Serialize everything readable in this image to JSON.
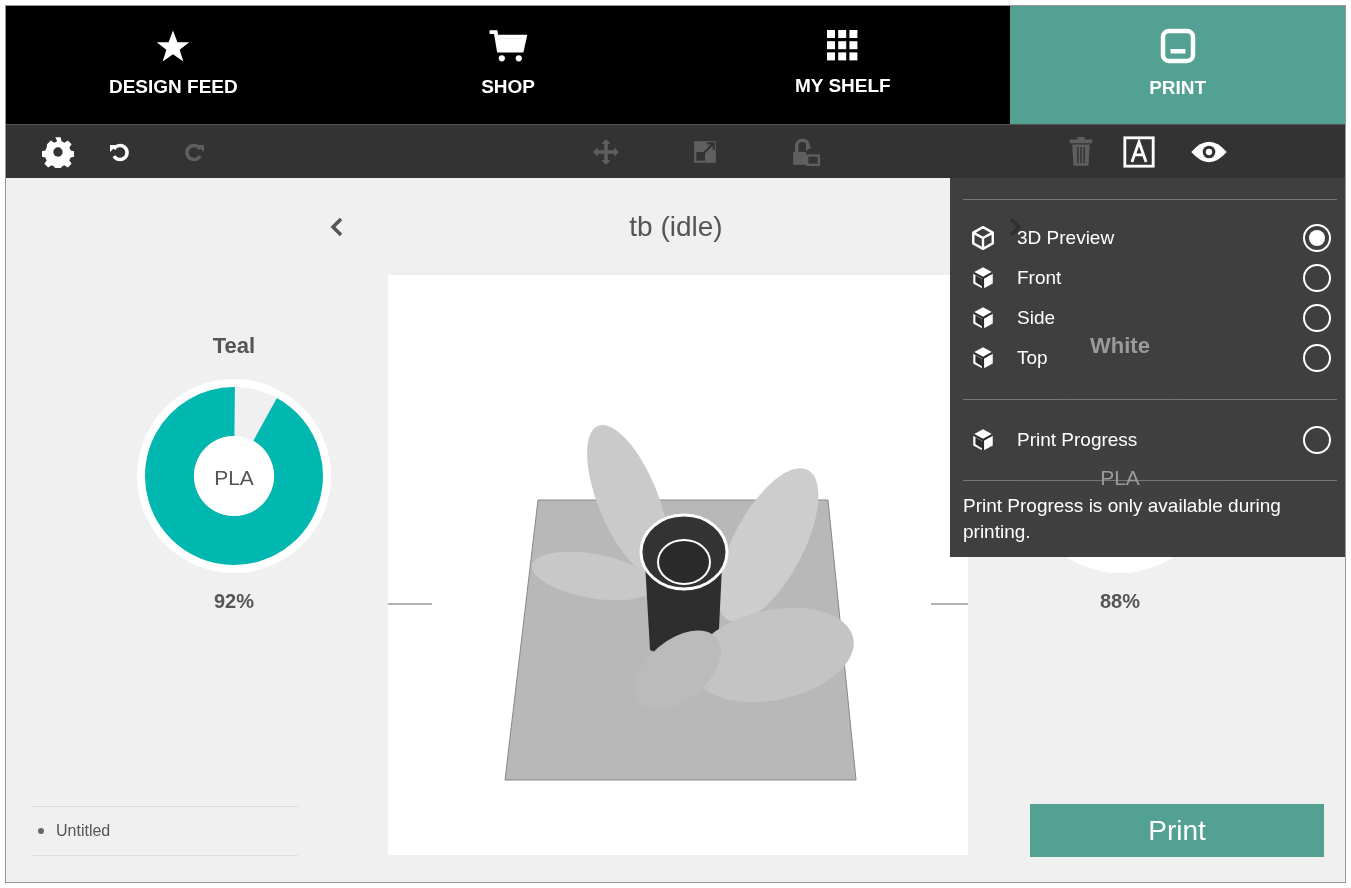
{
  "nav_tabs": [
    {
      "label": "DESIGN FEED",
      "selected": false
    },
    {
      "label": "SHOP",
      "selected": false
    },
    {
      "label": "MY SHELF",
      "selected": false
    },
    {
      "label": "PRINT",
      "selected": true
    }
  ],
  "toolbar": [
    {
      "disabled": false
    },
    {
      "disabled": false
    },
    {
      "disabled": true
    },
    {
      "disabled": true
    },
    {
      "disabled": true
    },
    {
      "disabled": true
    },
    {
      "disabled": true
    },
    {
      "disabled": false
    },
    {
      "disabled": false
    }
  ],
  "printer_status": "tb (idle)",
  "extruders": [
    {
      "name": "Teal",
      "material": "PLA",
      "reading": "92%",
      "level": 0.92,
      "color": "#00b8b0"
    },
    {
      "name": "White",
      "material": "PLA",
      "reading": "88%"
    }
  ],
  "files": [
    "Untitled"
  ],
  "print_button": "Print",
  "view_menu": {
    "views": [
      {
        "label": "3D Preview",
        "selected": true
      },
      {
        "label": "Front",
        "selected": false
      },
      {
        "label": "Side",
        "selected": false
      },
      {
        "label": "Top",
        "selected": false
      }
    ],
    "progress_option": {
      "label": "Print Progress",
      "selected": false
    },
    "note": "Print Progress is only available during printing."
  }
}
